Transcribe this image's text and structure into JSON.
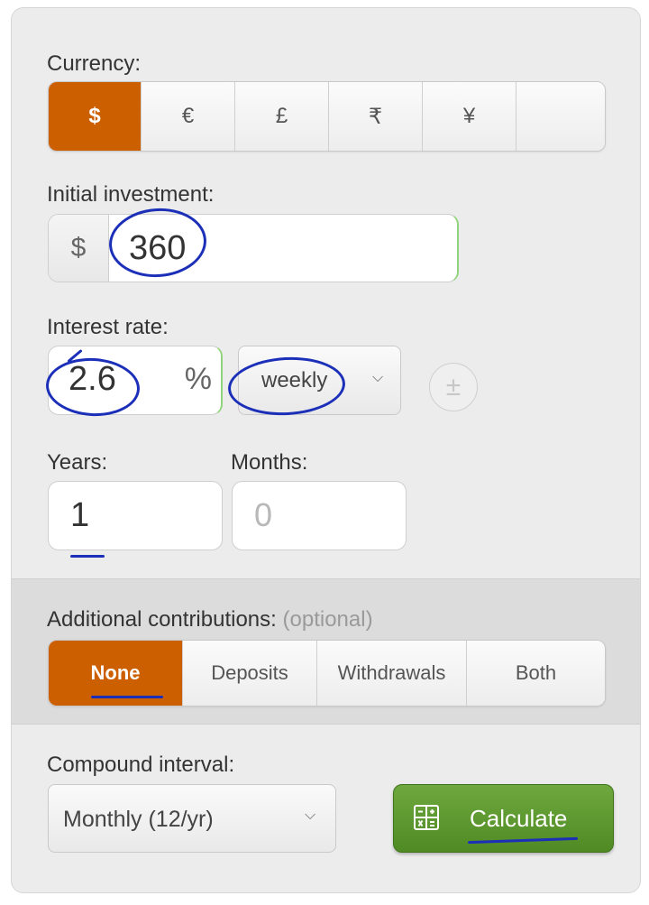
{
  "currency": {
    "label": "Currency:",
    "options": [
      "$",
      "€",
      "£",
      "₹",
      "¥",
      ""
    ],
    "selected": "$"
  },
  "initial_investment": {
    "label": "Initial investment:",
    "prefix": "$",
    "value": "360"
  },
  "interest_rate": {
    "label": "Interest rate:",
    "value": "2.6",
    "suffix": "%",
    "period": "weekly"
  },
  "years": {
    "label": "Years:",
    "value": "1"
  },
  "months": {
    "label": "Months:",
    "placeholder": "0"
  },
  "contributions": {
    "label": "Additional contributions:",
    "optional_note": "(optional)",
    "options": [
      "None",
      "Deposits",
      "Withdrawals",
      "Both"
    ],
    "selected": "None"
  },
  "compound": {
    "label": "Compound interval:",
    "value": "Monthly (12/yr)"
  },
  "calculate_label": "Calculate",
  "colors": {
    "accent": "#cc5f00",
    "button_green": "#5c9630",
    "annotation_ink": "#1b2fb8"
  }
}
